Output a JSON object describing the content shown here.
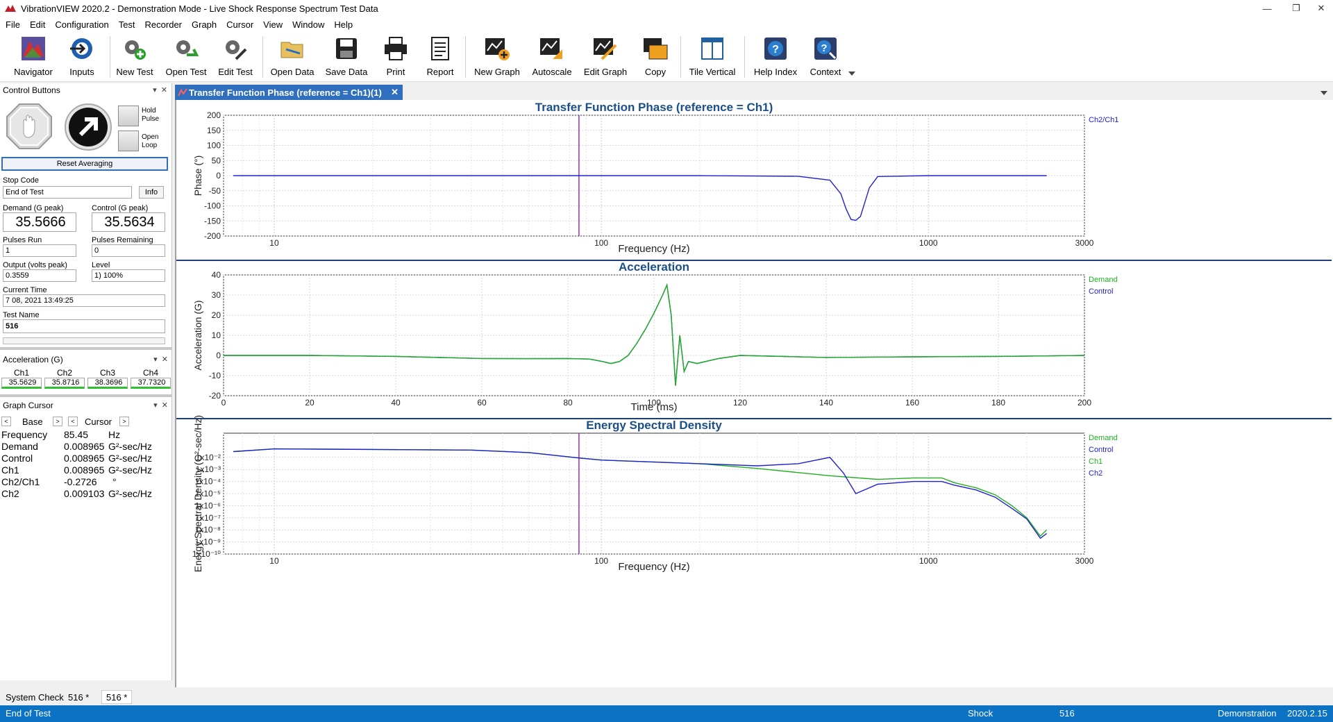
{
  "window": {
    "title": "VibrationVIEW 2020.2 - Demonstration Mode - Live Shock Response Spectrum Test Data",
    "minimize": "—",
    "restore": "❐",
    "close": "✕"
  },
  "menu": [
    "File",
    "Edit",
    "Configuration",
    "Test",
    "Recorder",
    "Graph",
    "Cursor",
    "View",
    "Window",
    "Help"
  ],
  "toolbar": [
    {
      "label": "Navigator",
      "icon": "navigator-icon"
    },
    {
      "label": "Inputs",
      "icon": "inputs-icon"
    },
    {
      "label": "New Test",
      "icon": "new-test-icon"
    },
    {
      "label": "Open Test",
      "icon": "open-test-icon"
    },
    {
      "label": "Edit Test",
      "icon": "edit-test-icon"
    },
    {
      "label": "Open Data",
      "icon": "open-data-icon"
    },
    {
      "label": "Save Data",
      "icon": "save-data-icon"
    },
    {
      "label": "Print",
      "icon": "print-icon"
    },
    {
      "label": "Report",
      "icon": "report-icon"
    },
    {
      "label": "New Graph",
      "icon": "new-graph-icon"
    },
    {
      "label": "Autoscale",
      "icon": "autoscale-icon"
    },
    {
      "label": "Edit Graph",
      "icon": "edit-graph-icon"
    },
    {
      "label": "Copy",
      "icon": "copy-icon"
    },
    {
      "label": "Tile Vertical",
      "icon": "tile-vertical-icon"
    },
    {
      "label": "Help Index",
      "icon": "help-index-icon"
    },
    {
      "label": "Context",
      "icon": "context-help-icon"
    }
  ],
  "control_panel": {
    "header": "Control Buttons",
    "hold_pulse": "Hold Pulse",
    "open_loop": "Open Loop",
    "reset_averaging": "Reset Averaging",
    "stop_code_label": "Stop Code",
    "stop_code_value": "End of Test",
    "info_button": "Info",
    "demand_label": "Demand (G peak)",
    "demand_value": "35.5666",
    "control_label": "Control (G peak)",
    "control_value": "35.5634",
    "pulses_run_label": "Pulses Run",
    "pulses_run_value": "1",
    "pulses_remaining_label": "Pulses Remaining",
    "pulses_remaining_value": "0",
    "output_label": "Output (volts peak)",
    "output_value": "0.3559",
    "level_label": "Level",
    "level_value": "1) 100%",
    "current_time_label": "Current Time",
    "current_time_value": "7 08, 2021 13:49:25",
    "test_name_label": "Test Name",
    "test_name_value": "516"
  },
  "acceleration_panel": {
    "header": "Acceleration (G)",
    "channels": [
      {
        "name": "Ch1",
        "value": "35.5629"
      },
      {
        "name": "Ch2",
        "value": "35.8716"
      },
      {
        "name": "Ch3",
        "value": "38.3696"
      },
      {
        "name": "Ch4",
        "value": "37.7320"
      }
    ]
  },
  "graph_cursor": {
    "header": "Graph Cursor",
    "base_label": "Base",
    "cursor_label": "Cursor",
    "rows": [
      {
        "name": "Frequency",
        "value": "85.45",
        "unit": "Hz"
      },
      {
        "name": "Demand",
        "value": "0.008965",
        "unit": "G²-sec/Hz"
      },
      {
        "name": "Control",
        "value": "0.008965",
        "unit": "G²-sec/Hz"
      },
      {
        "name": "Ch1",
        "value": "0.008965",
        "unit": "G²-sec/Hz"
      },
      {
        "name": "Ch2/Ch1",
        "value": "-0.2726",
        "unit": "°"
      },
      {
        "name": "Ch2",
        "value": "0.009103",
        "unit": "G²-sec/Hz"
      }
    ]
  },
  "document_tab": "Transfer Function Phase (reference = Ch1)(1)",
  "colors": {
    "accent": "#0b72c4",
    "series_blue": "#2020d0",
    "series_green": "#1fb01f",
    "cursor_line": "#9b30b0",
    "title_blue": "#1a4f8a"
  },
  "chart_data": [
    {
      "type": "line",
      "title": "Transfer Function Phase (reference = Ch1)",
      "xlabel": "Frequency (Hz)",
      "ylabel": "Phase (°)",
      "xscale": "log",
      "xlim": [
        7,
        3000
      ],
      "ylim": [
        -200,
        200
      ],
      "xticks": [
        "10",
        "100",
        "1000",
        "3000"
      ],
      "yticks": [
        "200",
        "150",
        "100",
        "50",
        "0",
        "-50",
        "-100",
        "-150",
        "-200"
      ],
      "cursor_x": 85.45,
      "legend": [
        "Ch2/Ch1"
      ],
      "series": [
        {
          "name": "Ch2/Ch1",
          "x": [
            7.5,
            50,
            100,
            200,
            400,
            500,
            540,
            560,
            580,
            600,
            620,
            660,
            700,
            1000,
            2000,
            2300
          ],
          "y": [
            0,
            0,
            0,
            0,
            -2,
            -15,
            -60,
            -110,
            -145,
            -148,
            -135,
            -40,
            -3,
            0,
            0,
            0
          ]
        }
      ]
    },
    {
      "type": "line",
      "title": "Acceleration",
      "xlabel": "Time (ms)",
      "ylabel": "Acceleration (G)",
      "xlim": [
        0,
        200
      ],
      "ylim": [
        -20,
        40
      ],
      "xticks": [
        "0",
        "20",
        "40",
        "60",
        "80",
        "100",
        "120",
        "140",
        "160",
        "180",
        "200"
      ],
      "yticks": [
        "40",
        "30",
        "20",
        "10",
        "0",
        "-10",
        "-20"
      ],
      "legend": [
        "Demand",
        "Control"
      ],
      "series": [
        {
          "name": "Control",
          "x": [
            0,
            20,
            40,
            60,
            70,
            80,
            85,
            88,
            90,
            92,
            94,
            96,
            98,
            100,
            102,
            103,
            104,
            105,
            106,
            107,
            108,
            110,
            112,
            115,
            120,
            140,
            160,
            180,
            200
          ],
          "y": [
            0,
            0,
            -0.5,
            -1.5,
            -1.6,
            -1.5,
            -1.8,
            -3,
            -4,
            -3,
            0,
            6,
            13,
            21,
            30,
            35,
            20,
            -15,
            10,
            -8,
            -3,
            -4,
            -3,
            -1.5,
            0,
            -1,
            -0.7,
            -0.5,
            0
          ]
        },
        {
          "name": "Demand",
          "x": [
            0,
            20,
            40,
            60,
            70,
            80,
            85,
            88,
            90,
            92,
            94,
            96,
            98,
            100,
            102,
            103,
            104,
            105,
            106,
            107,
            108,
            110,
            112,
            115,
            120,
            140,
            160,
            180,
            200
          ],
          "y": [
            0,
            0,
            -0.5,
            -1.5,
            -1.6,
            -1.5,
            -1.8,
            -3,
            -4,
            -3,
            0,
            6,
            13,
            21,
            30,
            35,
            20,
            -15,
            10,
            -8,
            -3,
            -4,
            -3,
            -1.5,
            0,
            -1,
            -0.7,
            -0.5,
            0
          ]
        }
      ]
    },
    {
      "type": "line",
      "title": "Energy Spectral Density",
      "xlabel": "Frequency (Hz)",
      "ylabel": "Energy Spectral Density (G²-sec/Hz)",
      "xscale": "log",
      "yscale": "log",
      "xlim": [
        7,
        3000
      ],
      "ylim": [
        1e-10,
        1
      ],
      "xticks": [
        "10",
        "100",
        "1000",
        "3000"
      ],
      "yticks": [
        "1x10⁻²",
        "1x10⁻³",
        "1x10⁻⁴",
        "1x10⁻⁵",
        "1x10⁻⁶",
        "1x10⁻⁷",
        "1x10⁻⁸",
        "1x10⁻⁹",
        "1x10⁻¹⁰"
      ],
      "cursor_x": 85.45,
      "legend": [
        "Demand",
        "Control",
        "Ch1",
        "Ch2"
      ],
      "series": [
        {
          "name": "Demand",
          "x": [
            7.5,
            10,
            20,
            40,
            60,
            85,
            100,
            200,
            300,
            500,
            700,
            900,
            1100,
            1200,
            1400,
            1600,
            1800,
            2000,
            2200,
            2300
          ],
          "y": [
            0.03,
            0.05,
            0.045,
            0.04,
            0.025,
            0.009,
            0.006,
            0.003,
            0.0012,
            0.0003,
            0.00015,
            0.0002,
            0.0002,
            8e-05,
            3e-05,
            8e-06,
            1e-06,
            1e-07,
            3e-09,
            1e-08
          ]
        },
        {
          "name": "Ch2",
          "x": [
            7.5,
            10,
            20,
            40,
            60,
            85,
            100,
            200,
            300,
            400,
            500,
            550,
            600,
            700,
            900,
            1100,
            1200,
            1400,
            1600,
            1800,
            2000,
            2200,
            2300
          ],
          "y": [
            0.03,
            0.05,
            0.045,
            0.04,
            0.025,
            0.009,
            0.006,
            0.003,
            0.002,
            0.003,
            0.01,
            0.0005,
            1e-05,
            6e-05,
            0.0001,
            0.0001,
            5e-05,
            2e-05,
            5e-06,
            6e-07,
            8e-08,
            2e-09,
            5e-09
          ]
        }
      ]
    }
  ],
  "bottom_tabs": [
    "System Check",
    "516 *",
    "516 *"
  ],
  "status": {
    "left": "End of Test",
    "test_type": "Shock",
    "test_name": "516",
    "mode": "Demonstration",
    "version": "2020.2.15"
  }
}
